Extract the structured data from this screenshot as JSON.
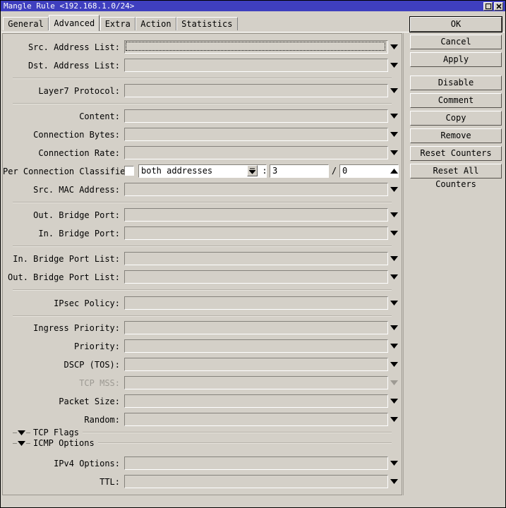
{
  "window": {
    "title": "Mangle Rule <192.168.1.0/24>",
    "titlebar_color": "#3f3fbf",
    "face_color": "#d4d0c8",
    "controls": [
      {
        "name": "maximize",
        "glyph": "maximize-icon"
      },
      {
        "name": "close",
        "glyph": "close-icon"
      }
    ]
  },
  "tabs": [
    {
      "label": "General",
      "active": false
    },
    {
      "label": "Advanced",
      "active": true
    },
    {
      "label": "Extra",
      "active": false
    },
    {
      "label": "Action",
      "active": false
    },
    {
      "label": "Statistics",
      "active": false
    }
  ],
  "form": {
    "rows": [
      {
        "label": "Src. Address List:",
        "value": "",
        "focused": true,
        "disabled": false,
        "arrow": "down"
      },
      {
        "label": "Dst. Address List:",
        "value": "",
        "focused": false,
        "disabled": false,
        "arrow": "down"
      },
      {
        "label": "Layer7 Protocol:",
        "value": "",
        "focused": false,
        "disabled": false,
        "arrow": "down"
      },
      {
        "label": "Content:",
        "value": "",
        "focused": false,
        "disabled": false,
        "arrow": "down"
      },
      {
        "label": "Connection Bytes:",
        "value": "",
        "focused": false,
        "disabled": false,
        "arrow": "down"
      },
      {
        "label": "Connection Rate:",
        "value": "",
        "focused": false,
        "disabled": false,
        "arrow": "down"
      },
      {
        "label": "Src. MAC Address:",
        "value": "",
        "focused": false,
        "disabled": false,
        "arrow": "down"
      },
      {
        "label": "Out. Bridge Port:",
        "value": "",
        "focused": false,
        "disabled": false,
        "arrow": "down"
      },
      {
        "label": "In. Bridge Port:",
        "value": "",
        "focused": false,
        "disabled": false,
        "arrow": "down"
      },
      {
        "label": "In. Bridge Port List:",
        "value": "",
        "focused": false,
        "disabled": false,
        "arrow": "down"
      },
      {
        "label": "Out. Bridge Port List:",
        "value": "",
        "focused": false,
        "disabled": false,
        "arrow": "down"
      },
      {
        "label": "IPsec Policy:",
        "value": "",
        "focused": false,
        "disabled": false,
        "arrow": "down"
      },
      {
        "label": "Ingress Priority:",
        "value": "",
        "focused": false,
        "disabled": false,
        "arrow": "down"
      },
      {
        "label": "Priority:",
        "value": "",
        "focused": false,
        "disabled": false,
        "arrow": "down"
      },
      {
        "label": "DSCP (TOS):",
        "value": "",
        "focused": false,
        "disabled": false,
        "arrow": "down"
      },
      {
        "label": "TCP MSS:",
        "value": "",
        "focused": false,
        "disabled": true,
        "arrow": "down"
      },
      {
        "label": "Packet Size:",
        "value": "",
        "focused": false,
        "disabled": false,
        "arrow": "down"
      },
      {
        "label": "Random:",
        "value": "",
        "focused": false,
        "disabled": false,
        "arrow": "down"
      },
      {
        "label": "IPv4 Options:",
        "value": "",
        "focused": false,
        "disabled": false,
        "arrow": "down"
      },
      {
        "label": "TTL:",
        "value": "",
        "focused": false,
        "disabled": false,
        "arrow": "down"
      }
    ],
    "pcc": {
      "label": "Per Connection Classifier:",
      "checkbox_checked": false,
      "mode": "both addresses",
      "separator1": ":",
      "denominator": "3",
      "separator2": "/",
      "remainder": "0",
      "arrow": "up"
    },
    "groups": [
      {
        "label": "TCP Flags",
        "expanded": true
      },
      {
        "label": "ICMP Options",
        "expanded": true
      }
    ]
  },
  "buttons": [
    {
      "label": "OK",
      "default": true
    },
    {
      "label": "Cancel",
      "default": false
    },
    {
      "label": "Apply",
      "default": false
    },
    {
      "label": "Disable",
      "default": false
    },
    {
      "label": "Comment",
      "default": false
    },
    {
      "label": "Copy",
      "default": false
    },
    {
      "label": "Remove",
      "default": false
    },
    {
      "label": "Reset Counters",
      "default": false
    },
    {
      "label": "Reset All Counters",
      "default": false
    }
  ]
}
